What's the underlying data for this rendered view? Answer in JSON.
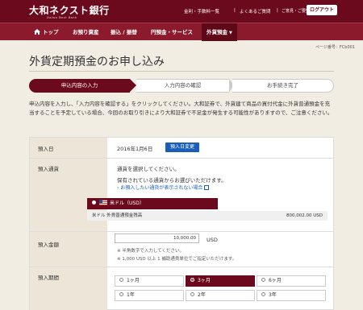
{
  "header": {
    "logo": "大和ネクスト銀行",
    "logo_sub": "Daiwa Next Bank",
    "util_links": [
      "金利・手数料一覧",
      "よくあるご質問",
      "ご意見・ご要望"
    ],
    "separator": "|",
    "logout": "ログアウト"
  },
  "nav": {
    "items": [
      "トップ",
      "お預り資産",
      "振込 / 振替",
      "円預金・サービス",
      "外貨預金"
    ]
  },
  "page": {
    "page_number": "ページ番号：FCb001",
    "title": "外貨定期預金のお申し込み"
  },
  "steps": [
    "申込内容の入力",
    "入力内容の確認",
    "お手続き完了"
  ],
  "intro": "申込内容を入力し、「入力内容を確認する」をクリックしてください。大和証券で、外貨建て商品の買付代金に外貨普通預金を充当することを予定している場合、今回のお取り引きにより大和証券で不足金が発生する可能性がありますので、ご注意ください。",
  "form": {
    "date_label": "預入日",
    "date_value": "2016年1月6日",
    "date_change": "預入日変更",
    "currency_label": "預入通貨",
    "currency_prompt": "通貨を選択してください。",
    "currency_note": "保有されている通貨からお選びいただけます。",
    "currency_link": "お預入したい通貨が表示されない場合",
    "currency_option": "米ドル（USD）",
    "balance_label": "米ドル 外貨普通預金残高",
    "balance_value": "800,002.00 USD",
    "amount_label": "預入金額",
    "amount_value": "10,000.00",
    "amount_unit": "USD",
    "amount_note1": "※ 半角数字で入力してください。",
    "amount_note2": "※ 1,000 USD 以上 1 補助通貨単位でご指定いただけます。",
    "period_label": "預入期間",
    "periods": [
      "1ヶ月",
      "3ヶ月",
      "6ヶ月",
      "1年",
      "2年",
      "3年"
    ],
    "period_selected": "3ヶ月"
  },
  "colors": {
    "brand": "#6b0a1c",
    "nav": "#8a1a2c",
    "link": "#1a5eb8"
  }
}
